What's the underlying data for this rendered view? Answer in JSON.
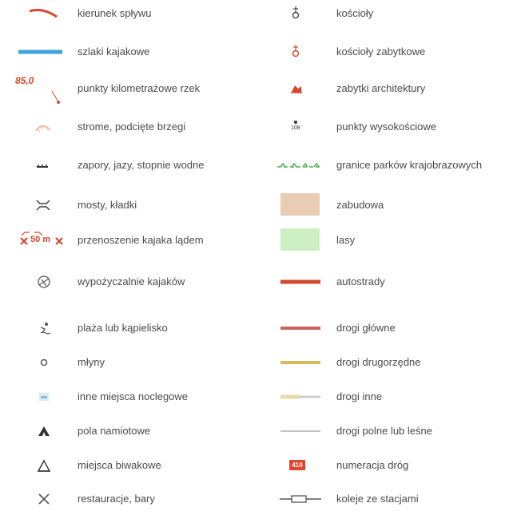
{
  "legend": {
    "left": [
      {
        "symbol": "flow-direction-arrow",
        "label": "kierunek spływu"
      },
      {
        "symbol": "kayak-trail-line",
        "label": "szlaki kajakowe"
      },
      {
        "symbol": "river-km-marker",
        "marker_text": "85,0",
        "label": "punkty kilometrażowe rzek"
      },
      {
        "symbol": "steep-bank",
        "label": "strome, podcięte brzegi"
      },
      {
        "symbol": "dam-weir",
        "label": "zapory, jazy, stopnie wodne"
      },
      {
        "symbol": "bridge",
        "label": "mosty, kładki"
      },
      {
        "symbol": "portage",
        "marker_text": "50 m",
        "label": "przenoszenie kajaka lądem"
      },
      {
        "symbol": "kayak-rental",
        "label": "wypożyczalnie kajaków"
      },
      {
        "symbol": "beach-swimming",
        "label": "plaża lub kąpielisko"
      },
      {
        "symbol": "mill",
        "label": "młyny"
      },
      {
        "symbol": "other-accommodation",
        "label": "inne miejsca noclegowe"
      },
      {
        "symbol": "campsite-tent",
        "label": "pola namiotowe"
      },
      {
        "symbol": "bivouac",
        "label": "miejsca biwakowe"
      },
      {
        "symbol": "restaurant",
        "label": "restauracje, bary"
      }
    ],
    "right": [
      {
        "symbol": "church",
        "label": "kościoły"
      },
      {
        "symbol": "historic-church",
        "label": "kościoły zabytkowe"
      },
      {
        "symbol": "architecture-monument",
        "label": "zabytki architektury"
      },
      {
        "symbol": "elevation-point",
        "marker_text": "108",
        "label": "punkty wysokościowe"
      },
      {
        "symbol": "landscape-park-border",
        "label": "granice parków krajobrazowych"
      },
      {
        "symbol": "built-up-area",
        "label": "zabudowa"
      },
      {
        "symbol": "forest-area",
        "label": "lasy"
      },
      {
        "symbol": "motorway",
        "label": "autostrady"
      },
      {
        "symbol": "main-road",
        "label": "drogi główne"
      },
      {
        "symbol": "secondary-road",
        "label": "drogi drugorzędne"
      },
      {
        "symbol": "other-road",
        "label": "drogi inne"
      },
      {
        "symbol": "field-forest-road",
        "label": "drogi polne lub leśne"
      },
      {
        "symbol": "road-number",
        "marker_text": "410",
        "label": "numeracja dróg"
      },
      {
        "symbol": "railway-stations",
        "label": "koleje ze stacjami"
      }
    ]
  },
  "colors": {
    "text": "#4a4a4a",
    "kayak_trail": "#3fa2dd",
    "red": "#d6472b",
    "motorway": "#d04a2e",
    "main_road": "#c8655a",
    "secondary_road": "#d9b95a",
    "other_road": "#e2dca8",
    "built_up": "#e8cdb4",
    "forest": "#cdeec0",
    "park_border": "#4caf50"
  }
}
